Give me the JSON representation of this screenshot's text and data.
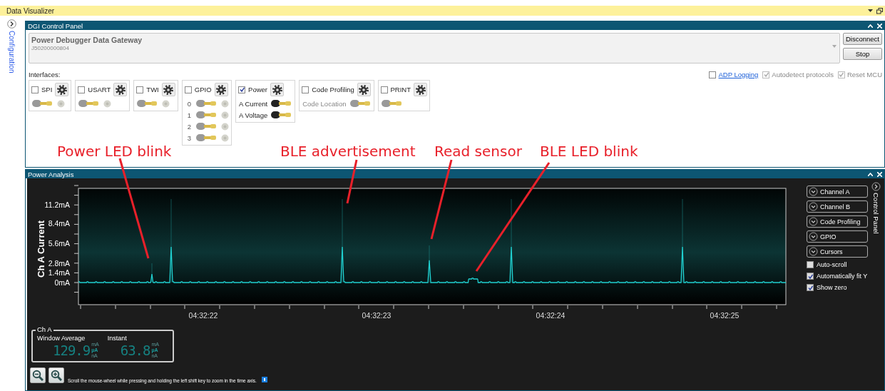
{
  "window": {
    "title": "Data Visualizer"
  },
  "sidebar": {
    "label": "Configuration"
  },
  "dgi_panel": {
    "title": "DGI Control Panel",
    "device": {
      "name": "Power Debugger Data Gateway",
      "serial": "J50200000804"
    },
    "buttons": [
      "Disconnect",
      "Stop"
    ],
    "interfaces_label": "Interfaces:",
    "options": [
      {
        "label": "ADP Logging",
        "kind": "link",
        "checked": false,
        "disabled": false
      },
      {
        "label": "Autodetect protocols",
        "kind": "plain",
        "checked": true,
        "disabled": true
      },
      {
        "label": "Reset MCU",
        "kind": "plain",
        "checked": true,
        "disabled": true
      }
    ],
    "interfaces": [
      {
        "label": "SPI",
        "checked": false,
        "rows": [
          {
            "active": false,
            "led": true
          }
        ]
      },
      {
        "label": "USART",
        "checked": false,
        "rows": [
          {
            "active": false,
            "led": true
          }
        ]
      },
      {
        "label": "TWI",
        "checked": false,
        "rows": [
          {
            "active": false,
            "led": true
          }
        ]
      },
      {
        "label": "GPIO",
        "checked": false,
        "rows": [
          {
            "label": "0",
            "active": false,
            "led": true
          },
          {
            "label": "1",
            "active": false,
            "led": true
          },
          {
            "label": "2",
            "active": false,
            "led": true
          },
          {
            "label": "3",
            "active": false,
            "led": true
          }
        ]
      },
      {
        "label": "Power",
        "checked": true,
        "rows": [
          {
            "label": "A Current",
            "active": true,
            "led": false
          },
          {
            "label": "A Voltage",
            "active": true,
            "led": false
          }
        ]
      },
      {
        "label": "Code Profiling",
        "checked": false,
        "rows": [
          {
            "label": "Code Location",
            "active": false,
            "led": false
          }
        ]
      },
      {
        "label": "PRINT",
        "checked": false,
        "rows": [
          {
            "active": false,
            "led": false
          }
        ]
      }
    ]
  },
  "annotations": [
    "Power LED blink",
    "BLE advertisement",
    "Read sensor",
    "BLE LED blink"
  ],
  "power_panel": {
    "title": "Power Analysis",
    "chart": {
      "ylabel": "Ch A Current",
      "yticks": [
        "11.2mA",
        "8.4mA",
        "5.6mA",
        "2.8mA",
        "1.4mA",
        "0mA"
      ],
      "xticks": [
        "04:32:22",
        "04:32:23",
        "04:32:24",
        "04:32:25"
      ]
    },
    "meter": {
      "title": "Ch A",
      "readings": [
        {
          "label": "Window Average",
          "value": "129.9",
          "units": [
            {
              "label": "mA",
              "selected": false
            },
            {
              "label": "µA",
              "selected": true
            },
            {
              "label": "nA",
              "selected": false
            }
          ]
        },
        {
          "label": "Instant",
          "value": "63.8",
          "units": [
            {
              "label": "mA",
              "selected": false
            },
            {
              "label": "µA",
              "selected": true
            },
            {
              "label": "nA",
              "selected": false
            }
          ]
        }
      ]
    },
    "hint": "Scroll the mouse-wheel while pressing and holding the left shift key to zoom in the time axis.",
    "control_panel": {
      "label": "Control Panel",
      "sections": [
        "Channel A",
        "Channel B",
        "Code Profiling",
        "GPIO",
        "Cursors"
      ],
      "options": [
        {
          "label": "Auto-scroll",
          "checked": false
        },
        {
          "label": "Automatically fit Y",
          "checked": true
        },
        {
          "label": "Show zero",
          "checked": true
        }
      ]
    }
  }
}
